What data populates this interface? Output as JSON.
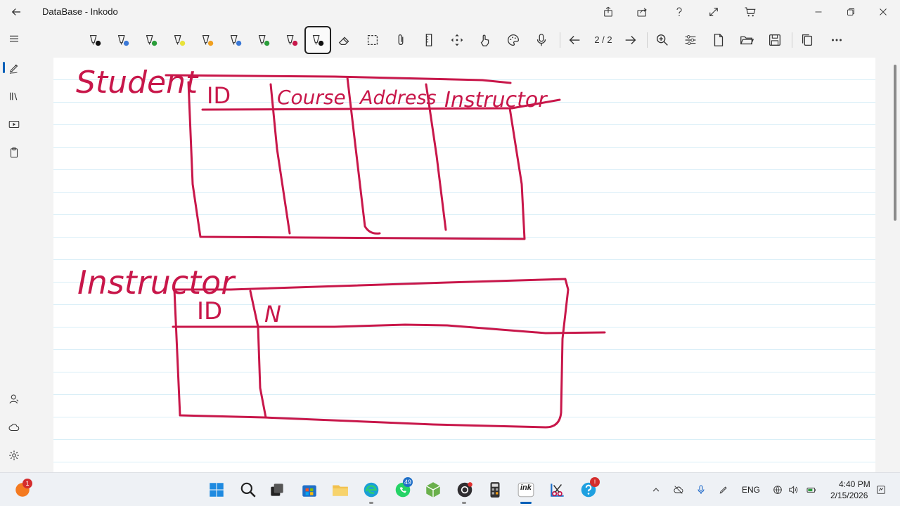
{
  "window": {
    "title": "DataBase - Inkodo",
    "back_icon": "back-arrow-icon",
    "actions": [
      "share-out-icon",
      "share-icon",
      "help-icon",
      "expand-icon",
      "cart-icon"
    ],
    "controls": [
      "minimize-icon",
      "restore-icon",
      "close-icon"
    ]
  },
  "toolbar": {
    "pens": [
      {
        "name": "pen-black",
        "color": "#111111"
      },
      {
        "name": "pen-blue",
        "color": "#3a78d6"
      },
      {
        "name": "pen-green",
        "color": "#2a9d3a"
      },
      {
        "name": "pen-yellow",
        "color": "#e8e23a"
      },
      {
        "name": "pen-orange",
        "color": "#f0a020"
      },
      {
        "name": "pen-blue-2",
        "color": "#3a78d6"
      },
      {
        "name": "pen-green-2",
        "color": "#2a9d3a"
      },
      {
        "name": "pen-red",
        "color": "#c8174a"
      },
      {
        "name": "pen-black-selected",
        "color": "#111111"
      }
    ],
    "tools": [
      "eraser-icon",
      "lasso-select-icon",
      "attach-icon",
      "ruler-icon",
      "move-icon",
      "touch-icon",
      "palette-icon",
      "microphone-icon"
    ],
    "page_indicator": "2 / 2",
    "right_tools": [
      "zoom-icon",
      "adjust-icon",
      "new-page-icon",
      "open-folder-icon",
      "save-icon",
      "copy-icon",
      "more-icon"
    ]
  },
  "left_rail": {
    "top_items": [
      "pen-mode-icon",
      "library-icon",
      "slides-icon",
      "clipboard-icon"
    ],
    "bottom_items": [
      "person-icon",
      "cloud-icon",
      "settings-icon"
    ]
  },
  "ink": {
    "color": "#c8174a",
    "table1": {
      "label": "Student",
      "headers": [
        "ID",
        "Course",
        "Address",
        "Instructor"
      ]
    },
    "table2": {
      "label": "Instructor",
      "headers": [
        "ID",
        "N"
      ]
    }
  },
  "taskbar": {
    "apps": [
      {
        "name": "start-button"
      },
      {
        "name": "search-button"
      },
      {
        "name": "task-view-button"
      },
      {
        "name": "store-app"
      },
      {
        "name": "file-explorer-app"
      },
      {
        "name": "edge-app"
      },
      {
        "name": "whatsapp-app",
        "badge": "49"
      },
      {
        "name": "cube-app"
      },
      {
        "name": "obs-app"
      },
      {
        "name": "calculator-app"
      },
      {
        "name": "inkodo-app",
        "label": "ink"
      },
      {
        "name": "snipping-tool-app"
      },
      {
        "name": "help-app"
      }
    ],
    "notification_badge": "1",
    "tray": {
      "language": "ENG",
      "time": "4:40 PM",
      "date": "2/15/2026"
    }
  }
}
